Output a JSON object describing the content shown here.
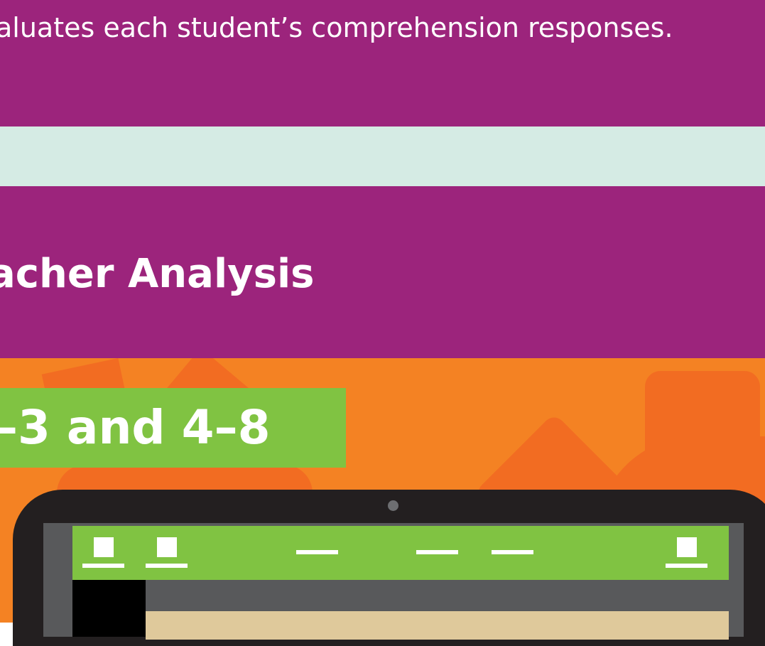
{
  "intro": {
    "description": "aluates each student’s comprehension responses."
  },
  "section": {
    "heading": "acher Analysis"
  },
  "banner": {
    "text": "–3 and 4–8"
  },
  "colors": {
    "purple": "#9c247c",
    "mint": "#d5ebe4",
    "orange": "#f48223",
    "green": "#80c342",
    "device_dark": "#231f20"
  },
  "laptop_toolbar": {
    "icons": [
      "document-icon",
      "document-icon",
      "dash-icon",
      "dash-icon",
      "dash-icon",
      "document-icon"
    ]
  }
}
